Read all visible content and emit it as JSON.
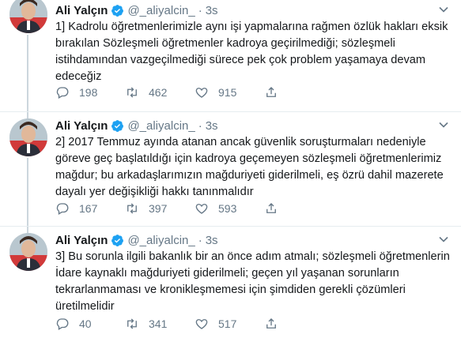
{
  "tweets": [
    {
      "author_name": "Ali Yalçın",
      "handle": "@_aliyalcin_",
      "separator": "·",
      "time": "3s",
      "text": "1] Kadrolu öğretmenlerimizle aynı işi yapmalarına rağmen özlük hakları eksik bırakılan Sözleşmeli öğretmenler kadroya geçirilmediği; sözleşmeli istihdamından vazgeçilmediği sürece pek çok problem yaşamaya devam edeceğiz",
      "replies": "198",
      "retweets": "462",
      "likes": "915"
    },
    {
      "author_name": "Ali Yalçın",
      "handle": "@_aliyalcin_",
      "separator": "·",
      "time": "3s",
      "text": "2] 2017 Temmuz ayında atanan ancak güvenlik soruşturmaları nedeniyle göreve geç başlatıldığı için kadroya geçemeyen sözleşmeli öğretmenlerimiz mağdur; bu arkadaşlarımızın mağduriyeti giderilmeli, eş özrü dahil mazerete dayalı yer değişikliği hakkı tanınmalıdır",
      "replies": "167",
      "retweets": "397",
      "likes": "593"
    },
    {
      "author_name": "Ali Yalçın",
      "handle": "@_aliyalcin_",
      "separator": "·",
      "time": "3s",
      "text": "3] Bu sorunla ilgili bakanlık bir an önce adım atmalı; sözleşmeli öğretmenlerin İdare kaynaklı mağduriyeti giderilmeli; geçen yıl yaşanan sorunların tekrarlanmaması ve kronikleşmemesi için şimdiden gerekli çözümleri üretilmelidir",
      "replies": "40",
      "retweets": "341",
      "likes": "517"
    }
  ],
  "icons": {
    "verified": "verified-badge-icon",
    "more": "chevron-down-icon",
    "reply": "reply-icon",
    "retweet": "retweet-icon",
    "like": "heart-icon",
    "share": "share-icon"
  },
  "colors": {
    "verified": "#1da1f2",
    "secondary_text": "#657786",
    "thread_line": "#ccd6dd"
  }
}
